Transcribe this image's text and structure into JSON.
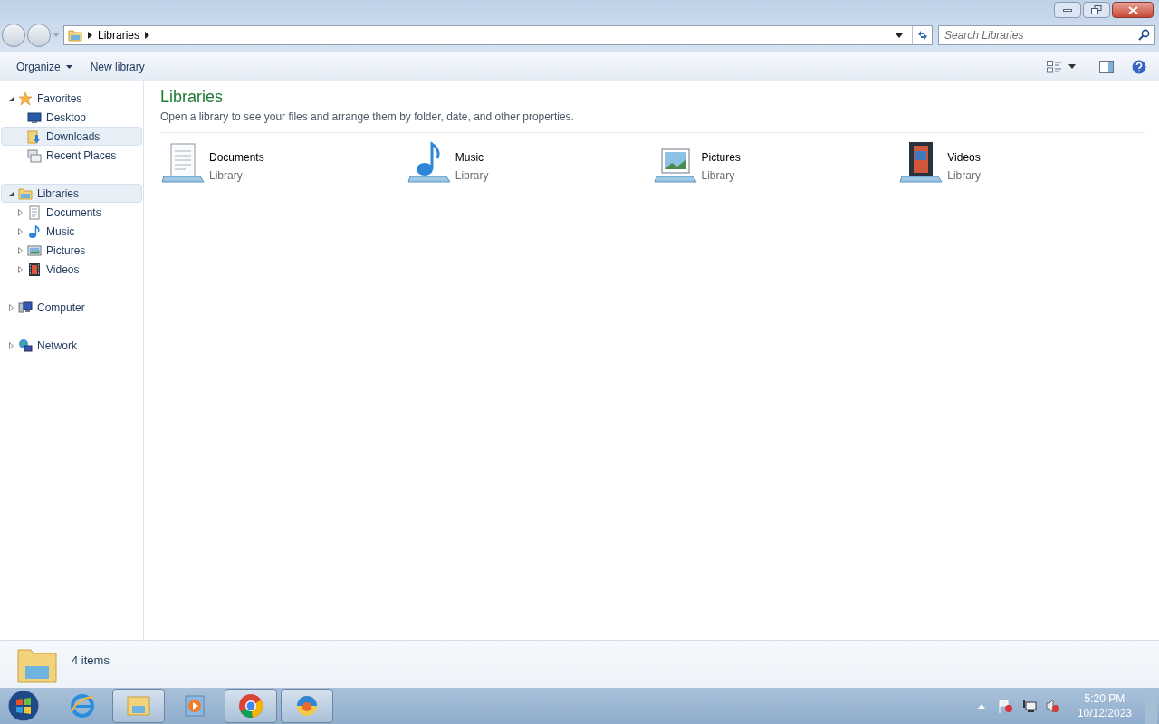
{
  "address": {
    "breadcrumb": [
      "Libraries"
    ]
  },
  "search": {
    "placeholder": "Search Libraries"
  },
  "toolbar": [
    {
      "label": "Organize",
      "menu": true
    },
    {
      "label": "New library",
      "menu": false
    }
  ],
  "nav": [
    {
      "label": "Favorites",
      "kind": "star",
      "expanded": true,
      "selected": false,
      "children": [
        {
          "label": "Desktop",
          "kind": "desktop",
          "selected": false
        },
        {
          "label": "Downloads",
          "kind": "download",
          "selected": true
        },
        {
          "label": "Recent Places",
          "kind": "recent",
          "selected": false
        }
      ]
    },
    {
      "label": "Libraries",
      "kind": "library",
      "expanded": true,
      "selected": true,
      "children": [
        {
          "label": "Documents",
          "kind": "documents",
          "expanded": false,
          "selected": false
        },
        {
          "label": "Music",
          "kind": "music",
          "expanded": false,
          "selected": false
        },
        {
          "label": "Pictures",
          "kind": "pictures",
          "expanded": false,
          "selected": false
        },
        {
          "label": "Videos",
          "kind": "videos",
          "expanded": false,
          "selected": false
        }
      ]
    },
    {
      "label": "Computer",
      "kind": "computer",
      "expanded": false,
      "selected": false
    },
    {
      "label": "Network",
      "kind": "network",
      "expanded": false,
      "selected": false
    }
  ],
  "content": {
    "title": "Libraries",
    "description": "Open a library to see your files and arrange them by folder, date, and other properties.",
    "items": [
      {
        "name": "Documents",
        "type": "Library",
        "kind": "documents"
      },
      {
        "name": "Music",
        "type": "Library",
        "kind": "music"
      },
      {
        "name": "Pictures",
        "type": "Library",
        "kind": "pictures"
      },
      {
        "name": "Videos",
        "type": "Library",
        "kind": "videos"
      }
    ]
  },
  "status_bar": {
    "count": "4 items"
  },
  "taskbar": {
    "apps": [
      {
        "kind": "browser-e",
        "open": false
      },
      {
        "kind": "folder",
        "open": true
      },
      {
        "kind": "media",
        "open": false
      },
      {
        "kind": "chrome",
        "open": true
      },
      {
        "kind": "swirl",
        "open": true
      }
    ],
    "time": "5:20 PM",
    "date": "10/12/2023"
  }
}
